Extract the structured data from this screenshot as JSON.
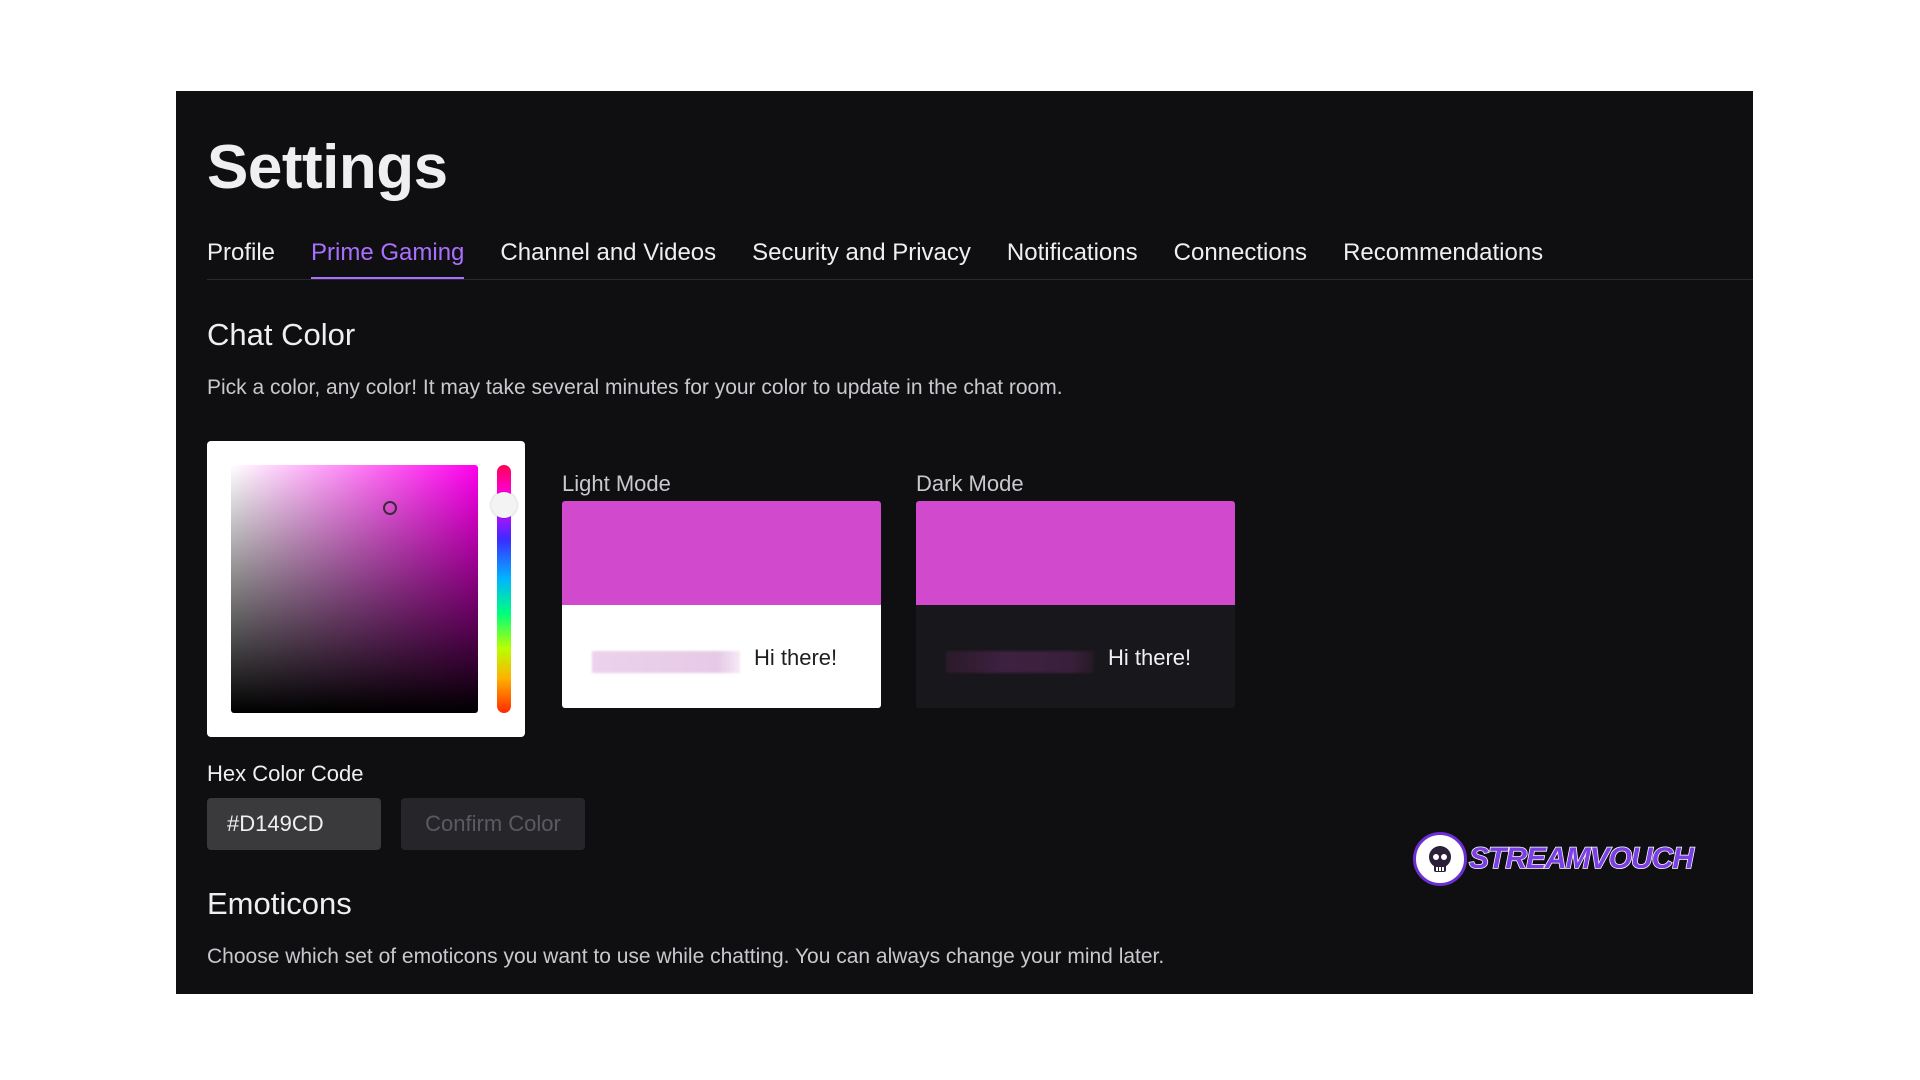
{
  "page": {
    "title": "Settings"
  },
  "tabs": [
    {
      "label": "Profile",
      "active": false
    },
    {
      "label": "Prime Gaming",
      "active": true
    },
    {
      "label": "Channel and Videos",
      "active": false
    },
    {
      "label": "Security and Privacy",
      "active": false
    },
    {
      "label": "Notifications",
      "active": false
    },
    {
      "label": "Connections",
      "active": false
    },
    {
      "label": "Recommendations",
      "active": false
    }
  ],
  "chat_color": {
    "title": "Chat Color",
    "description": "Pick a color, any color! It may take several minutes for your color to update in the chat room.",
    "selected_color": "#D149CD",
    "light_mode": {
      "label": "Light Mode",
      "message": "Hi there!"
    },
    "dark_mode": {
      "label": "Dark Mode",
      "message": "Hi there!"
    },
    "hex_label": "Hex Color Code",
    "hex_value": "#D149CD",
    "confirm_label": "Confirm Color"
  },
  "emoticons": {
    "title": "Emoticons",
    "description": "Choose which set of emoticons you want to use while chatting. You can always change your mind later."
  },
  "watermark": {
    "text": "STREAMVOUCH"
  },
  "colors": {
    "background": "#0f0e11",
    "accent": "#a970ff",
    "text": "#efeff1",
    "muted_text": "#c8c8cd"
  }
}
